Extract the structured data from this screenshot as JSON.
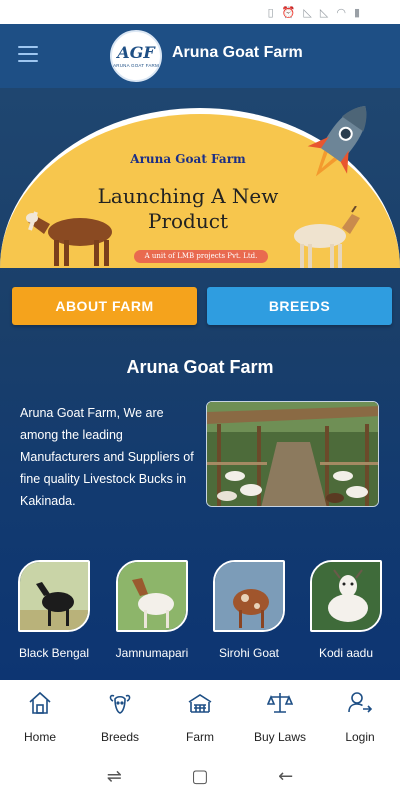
{
  "app": {
    "title": "Aruna Goat Farm",
    "logo_text": "AGF",
    "logo_subtext": "ARUNA GOAT FARM"
  },
  "banner": {
    "small_title": "Aruna Goat Farm",
    "headline_line1": "Launching A New",
    "headline_line2": "Product",
    "unit_text": "A unit of LMB projects Pvt. Ltd."
  },
  "tabs": [
    {
      "label": "ABOUT FARM",
      "color": "#f5a31c"
    },
    {
      "label": "BREEDS",
      "color": "#2f9de0"
    }
  ],
  "about": {
    "title": "Aruna Goat Farm",
    "description": "Aruna Goat Farm, We are among the leading Manufacturers and Suppliers of fine quality Livestock Bucks in Kakinada."
  },
  "breeds": [
    {
      "name": "Black Bengal"
    },
    {
      "name": "Jamnumapari"
    },
    {
      "name": "Sirohi Goat"
    },
    {
      "name": "Kodi aadu"
    }
  ],
  "bottom_nav": [
    {
      "label": "Home",
      "icon": "home-icon"
    },
    {
      "label": "Breeds",
      "icon": "goat-head-icon"
    },
    {
      "label": "Farm",
      "icon": "farm-icon"
    },
    {
      "label": "Buy Laws",
      "icon": "scale-icon"
    },
    {
      "label": "Login",
      "icon": "user-login-icon"
    }
  ],
  "colors": {
    "app_bar": "#1e4f85",
    "banner": "#f7c64d",
    "nav_icon": "#1e4f85"
  }
}
